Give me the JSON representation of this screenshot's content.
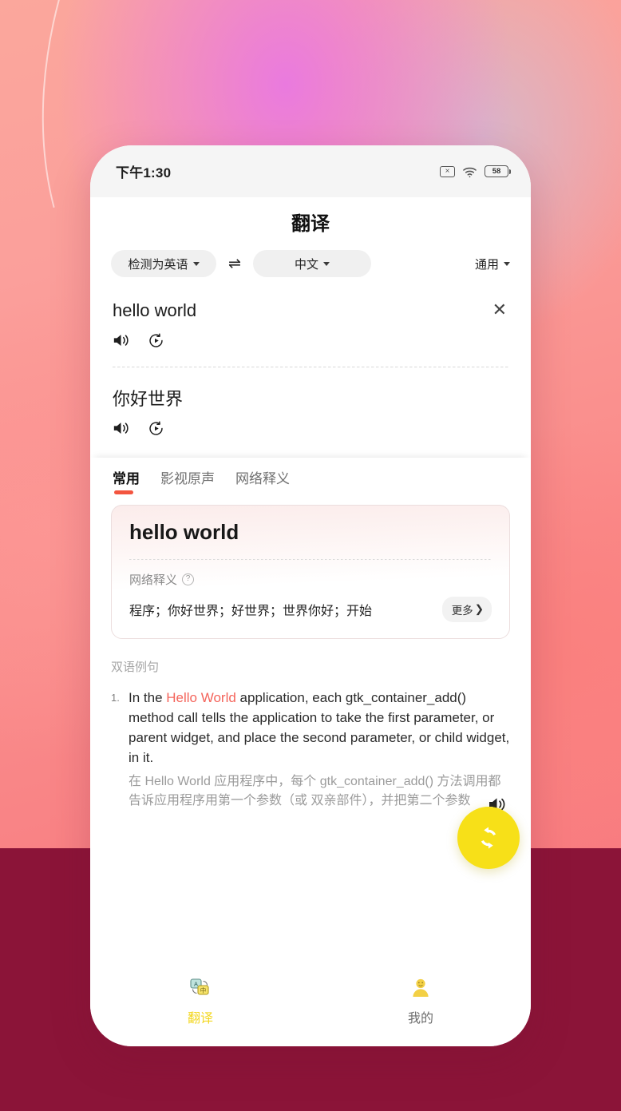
{
  "background": {
    "top_gradient": "#fba79c",
    "accent_magenta": "#e978e2",
    "bottom_band": "#8b1438"
  },
  "status_bar": {
    "time": "下午1:30",
    "no_sim_icon": "no-sim-icon",
    "no_sim_glyph": "×",
    "wifi_icon": "wifi-icon",
    "battery_icon": "battery-icon",
    "battery_level": "58"
  },
  "app_bar": {
    "title": "翻译"
  },
  "language_bar": {
    "source_label": "检测为英语",
    "swap_glyph": "⇌",
    "target_label": "中文",
    "mode_label": "通用"
  },
  "translation": {
    "source_text": "hello world",
    "clear_glyph": "✕",
    "source_speaker_icon": "speaker-icon",
    "source_slow_icon": "slow-playback-icon",
    "target_text": "你好世界",
    "target_speaker_icon": "speaker-icon",
    "target_slow_icon": "slow-playback-icon"
  },
  "tabs": [
    {
      "label": "常用",
      "active": true
    },
    {
      "label": "影视原声",
      "active": false
    },
    {
      "label": "网络释义",
      "active": false
    }
  ],
  "dictionary_card": {
    "word": "hello world",
    "section_label": "网络释义",
    "help_glyph": "?",
    "definitions": "程序；你好世界；好世界；世界你好；开始",
    "more_label": "更多",
    "more_chevron": "❯"
  },
  "examples": {
    "section_label": "双语例句",
    "items": [
      {
        "number": "1.",
        "en_before": "In the ",
        "en_highlight": "Hello World",
        "en_after": " application, each gtk_container_add() method call tells the application to take the first parameter, or parent widget, and place the second parameter, or child widget, in it.",
        "zh": "在 Hello World 应用程序中，每个 gtk_container_add() 方法调用都告诉应用程序用第一个参数（或 双亲部件），并把第二个参数",
        "speaker_icon": "speaker-icon"
      }
    ]
  },
  "fab": {
    "icon": "refresh-icon",
    "color": "#f7e018"
  },
  "bottom_nav": [
    {
      "label": "翻译",
      "icon": "translate-icon",
      "active": true,
      "color": "#f3d721"
    },
    {
      "label": "我的",
      "icon": "person-icon",
      "active": false,
      "color": "#6e6e6e"
    }
  ]
}
